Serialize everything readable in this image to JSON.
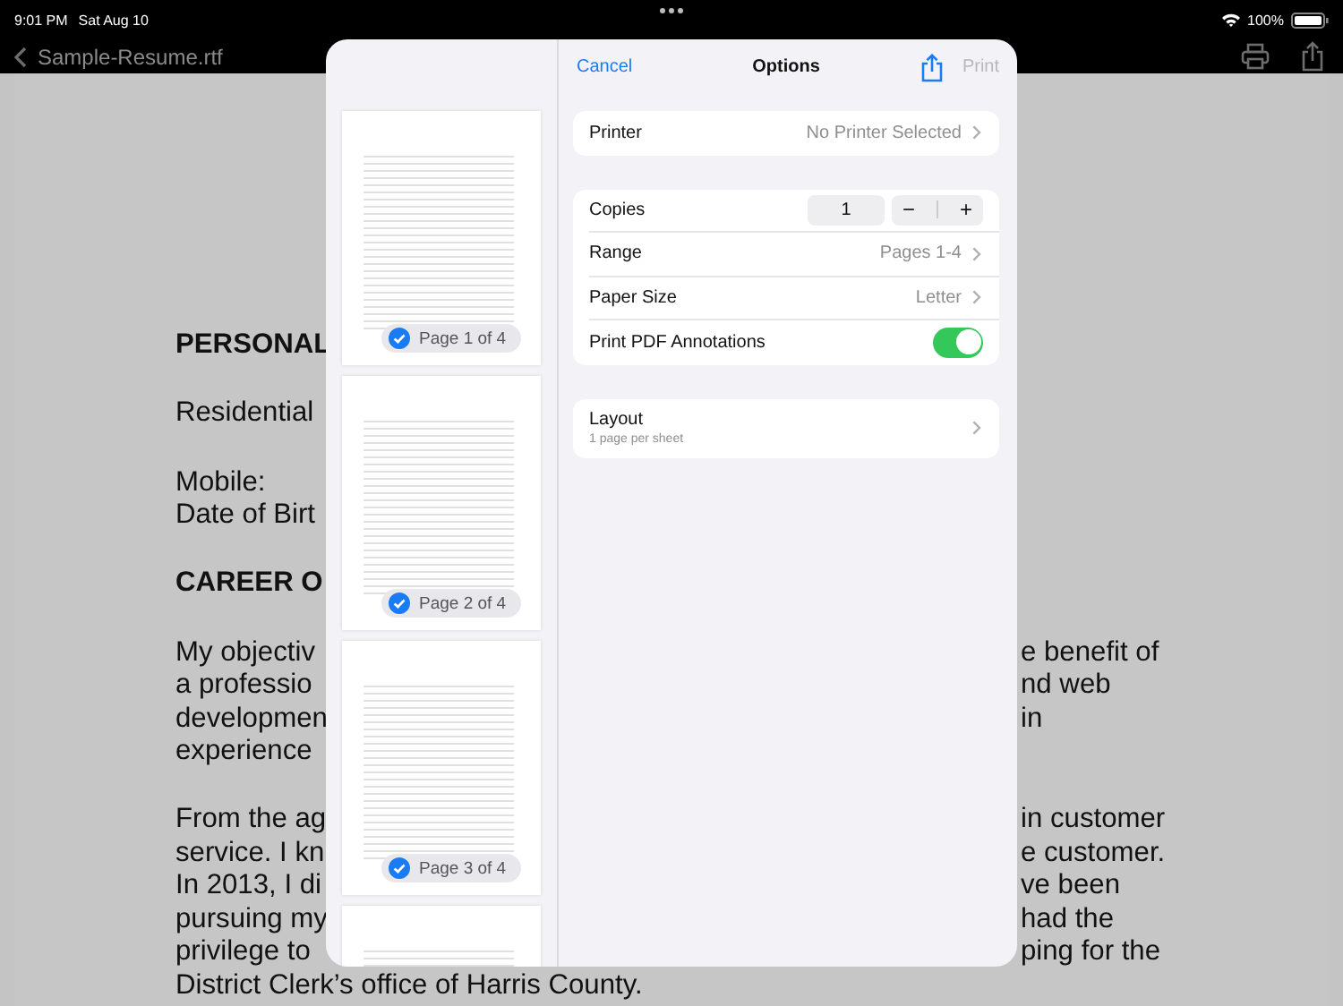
{
  "status_bar": {
    "time": "9:01 PM",
    "date": "Sat Aug 10",
    "battery": "100%"
  },
  "nav_bar": {
    "back_title": "Sample-Resume.rtf"
  },
  "document": {
    "blocks": [
      {
        "kind": "heading",
        "lines": [
          {
            "left": "PERSONAL"
          }
        ]
      },
      {
        "kind": "text",
        "lines": [
          {
            "left": "Residential"
          }
        ]
      },
      {
        "kind": "text",
        "lines": [
          {
            "left": "Mobile:"
          },
          {
            "left": "Date of Birt"
          }
        ]
      },
      {
        "kind": "heading",
        "lines": [
          {
            "left": "CAREER O"
          }
        ]
      },
      {
        "kind": "text",
        "lines": [
          {
            "left": "My objectiv",
            "right": "e benefit of"
          },
          {
            "left": "a professio",
            "right": "nd web"
          },
          {
            "left": "developmen",
            "right": "in"
          },
          {
            "left": "experience"
          }
        ]
      },
      {
        "kind": "text",
        "lines": [
          {
            "left": "From the ag",
            "right": "in customer"
          },
          {
            "left": "service. I kn",
            "right": "e customer."
          },
          {
            "left": "In 2013, I di",
            "right": "ve been"
          },
          {
            "left": "pursuing my",
            "right": "had the"
          },
          {
            "left": "privilege to",
            "right": "ping for the"
          },
          {
            "left": "District Clerk’s office of Harris County."
          }
        ]
      }
    ]
  },
  "print_sheet": {
    "pages": [
      {
        "label": "Page 1 of 4",
        "checked": true
      },
      {
        "label": "Page 2 of 4",
        "checked": true
      },
      {
        "label": "Page 3 of 4",
        "checked": true
      }
    ],
    "more_pages": true,
    "header": {
      "cancel": "Cancel",
      "title": "Options",
      "print": "Print",
      "print_disabled": true
    },
    "groups": [
      [
        {
          "kind": "link",
          "label": "Printer",
          "value": "No Printer Selected"
        }
      ],
      [
        {
          "kind": "stepper",
          "label": "Copies",
          "value": "1",
          "minus": "−",
          "plus": "+"
        },
        {
          "kind": "link",
          "label": "Range",
          "value": "Pages 1-4"
        },
        {
          "kind": "link",
          "label": "Paper Size",
          "value": "Letter"
        },
        {
          "kind": "toggle",
          "label": "Print PDF Annotations",
          "on": true
        }
      ],
      [
        {
          "kind": "link",
          "label": "Layout",
          "subtitle": "1 page per sheet"
        }
      ]
    ]
  }
}
